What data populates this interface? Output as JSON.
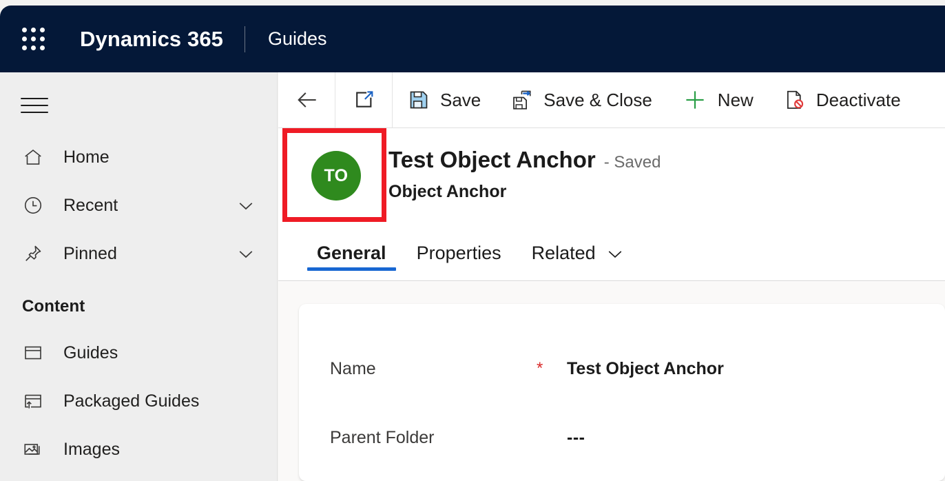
{
  "topbar": {
    "waffle_icon": "waffle-grid-icon",
    "brand": "Dynamics 365",
    "app_name": "Guides"
  },
  "sidebar": {
    "menu_icon": "hamburger-icon",
    "items": [
      {
        "label": "Home",
        "icon": "home-icon",
        "expandable": false
      },
      {
        "label": "Recent",
        "icon": "clock-icon",
        "expandable": true
      },
      {
        "label": "Pinned",
        "icon": "pin-icon",
        "expandable": true
      }
    ],
    "group_title": "Content",
    "group_items": [
      {
        "label": "Guides",
        "icon": "window-icon"
      },
      {
        "label": "Packaged Guides",
        "icon": "window-upload-icon"
      },
      {
        "label": "Images",
        "icon": "images-icon"
      }
    ]
  },
  "commandbar": {
    "back_icon": "arrow-left-icon",
    "popout_icon": "open-in-new-window-icon",
    "buttons": [
      {
        "label": "Save",
        "icon": "save-floppy-icon"
      },
      {
        "label": "Save & Close",
        "icon": "save-and-close-icon"
      },
      {
        "label": "New",
        "icon": "plus-icon"
      },
      {
        "label": "Deactivate",
        "icon": "deactivate-document-icon"
      }
    ]
  },
  "record": {
    "avatar_initials": "TO",
    "avatar_color": "#2f8a1e",
    "title": "Test Object Anchor",
    "status": "- Saved",
    "subtitle": "Object Anchor",
    "highlight_color": "#ef1b25"
  },
  "tabs": [
    {
      "label": "General",
      "active": true,
      "has_chevron": false
    },
    {
      "label": "Properties",
      "active": false,
      "has_chevron": false
    },
    {
      "label": "Related",
      "active": false,
      "has_chevron": true
    }
  ],
  "form": {
    "fields": [
      {
        "label": "Name",
        "required": "*",
        "value": "Test Object Anchor"
      },
      {
        "label": "Parent Folder",
        "required": "",
        "value": "---"
      }
    ]
  },
  "colors": {
    "header_navy": "#041838",
    "sidebar_bg": "#eeeeee",
    "form_bg": "#faf9f8",
    "tab_accent": "#1867d2",
    "required_red": "#d92b2b"
  }
}
